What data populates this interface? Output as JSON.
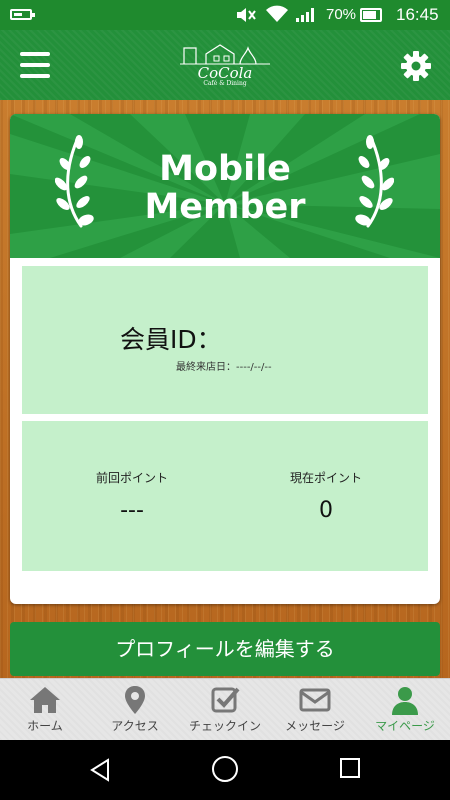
{
  "status_bar": {
    "battery_percent": "70%",
    "time": "16:45"
  },
  "header": {
    "logo_text": "CoCola",
    "logo_subtext": "Café & Dining",
    "menu_icon": "hamburger-icon",
    "settings_icon": "gear-icon"
  },
  "card": {
    "banner_title_line1": "Mobile",
    "banner_title_line2": "Member",
    "member_id_label": "会員ID：",
    "last_visit": "最終来店日：----/--/--",
    "points": {
      "previous_label": "前回ポイント",
      "previous_value": "---",
      "current_label": "現在ポイント",
      "current_value": "0"
    }
  },
  "edit_profile_button": "プロフィールを編集する",
  "tabs": [
    {
      "label": "ホーム",
      "icon": "home-icon",
      "active": false
    },
    {
      "label": "アクセス",
      "icon": "map-pin-icon",
      "active": false
    },
    {
      "label": "チェックイン",
      "icon": "checkin-icon",
      "active": false
    },
    {
      "label": "メッセージ",
      "icon": "mail-icon",
      "active": false
    },
    {
      "label": "マイページ",
      "icon": "user-icon",
      "active": true
    }
  ],
  "colors": {
    "primary_green": "#23903a",
    "light_green": "#c5f0cb",
    "active_tab": "#3b9a4a"
  }
}
